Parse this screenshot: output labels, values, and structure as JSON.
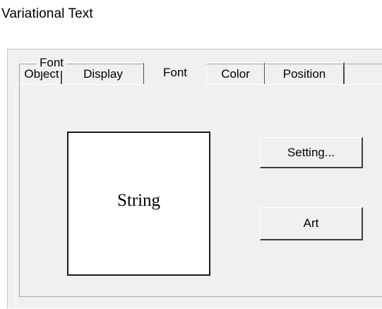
{
  "window": {
    "title": "Variational Text"
  },
  "tabs": [
    {
      "label": "Object",
      "active": false
    },
    {
      "label": "Display",
      "active": false
    },
    {
      "label": "Font",
      "active": true
    },
    {
      "label": "Color",
      "active": false
    },
    {
      "label": "Position",
      "active": false
    }
  ],
  "font_group": {
    "label": "Font",
    "preview_text": "String",
    "setting_button": "Setting...",
    "art_button": "Art"
  }
}
